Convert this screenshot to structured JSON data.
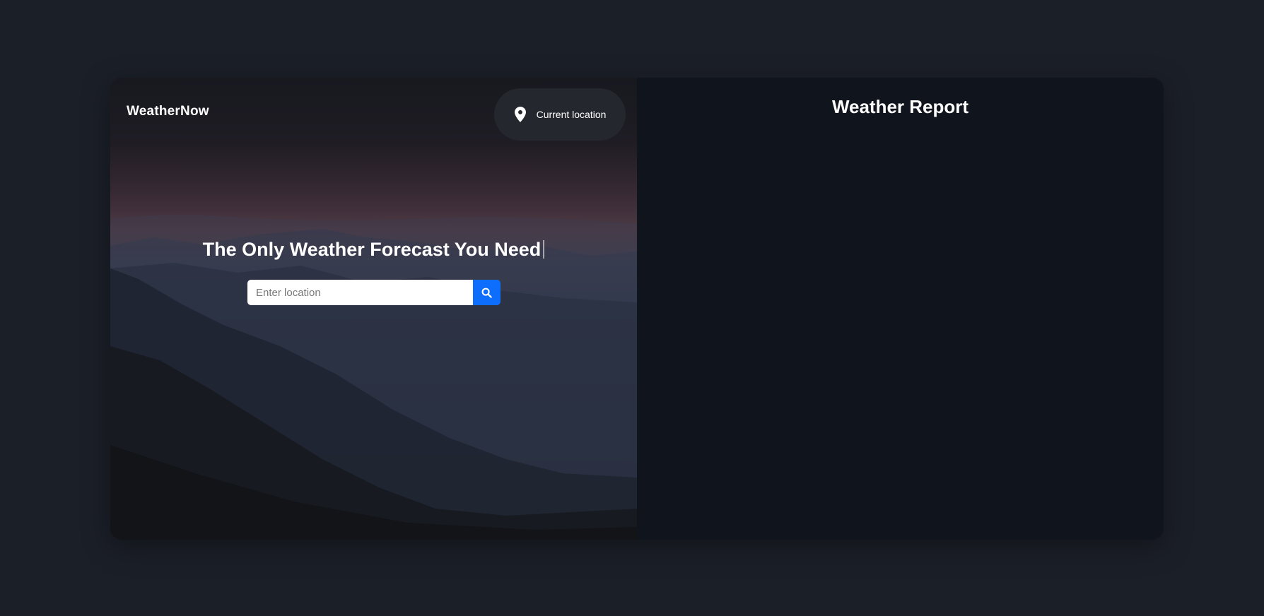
{
  "brand": "WeatherNow",
  "location_button": {
    "label": "Current location",
    "icon": "map-pin-icon"
  },
  "hero": {
    "headline": "The Only Weather Forecast You Need"
  },
  "search": {
    "placeholder": "Enter location",
    "value": "",
    "icon": "search-icon",
    "button_color": "#0d6efd"
  },
  "report": {
    "title": "Weather Report"
  },
  "colors": {
    "page_bg": "#1b1f28",
    "report_bg": "#10141c",
    "accent": "#0d6efd"
  }
}
